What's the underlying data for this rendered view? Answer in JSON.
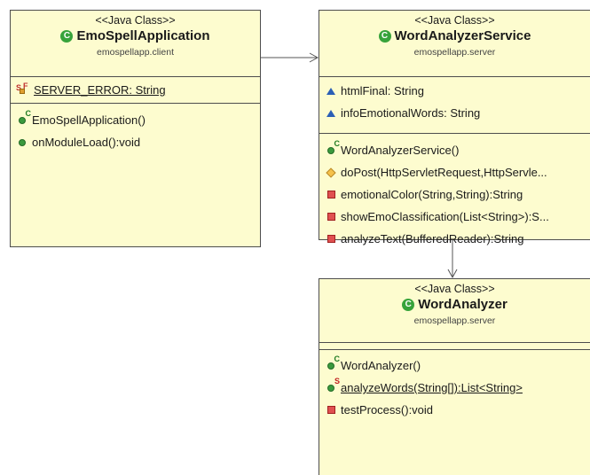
{
  "classes": {
    "emo": {
      "stereotype": "<<Java Class>>",
      "name": "EmoSpellApplication",
      "package": "emospellapp.client",
      "fields": [
        {
          "text": "SERVER_ERROR: String",
          "icon": "static-final-field-icon"
        }
      ],
      "methods": [
        {
          "text": "EmoSpellApplication()",
          "icon": "constructor-icon"
        },
        {
          "text": "onModuleLoad():void",
          "icon": "public-method-icon"
        }
      ]
    },
    "service": {
      "stereotype": "<<Java Class>>",
      "name": "WordAnalyzerService",
      "package": "emospellapp.server",
      "fields": [
        {
          "text": "htmlFinal: String",
          "icon": "package-field-icon"
        },
        {
          "text": "infoEmotionalWords: String",
          "icon": "package-field-icon"
        }
      ],
      "methods": [
        {
          "text": "WordAnalyzerService()",
          "icon": "constructor-icon"
        },
        {
          "text": "doPost(HttpServletRequest,HttpServle...",
          "icon": "protected-method-icon"
        },
        {
          "text": "emotionalColor(String,String):String",
          "icon": "private-method-icon"
        },
        {
          "text": "showEmoClassification(List<String>):S...",
          "icon": "private-method-icon"
        },
        {
          "text": "analyzeText(BufferedReader):String",
          "icon": "private-method-icon"
        }
      ]
    },
    "analyzer": {
      "stereotype": "<<Java Class>>",
      "name": "WordAnalyzer",
      "package": "emospellapp.server",
      "fields": [],
      "methods": [
        {
          "text": "WordAnalyzer()",
          "icon": "constructor-icon"
        },
        {
          "text": "analyzeWords(String[]):List<String>",
          "icon": "static-method-icon"
        },
        {
          "text": "testProcess():void",
          "icon": "private-method-icon"
        }
      ]
    }
  },
  "class_icon_letter": "C",
  "colors": {
    "class_fill": "#fdfccf",
    "border": "#4d4d4d",
    "class_icon": "#37a33b"
  }
}
